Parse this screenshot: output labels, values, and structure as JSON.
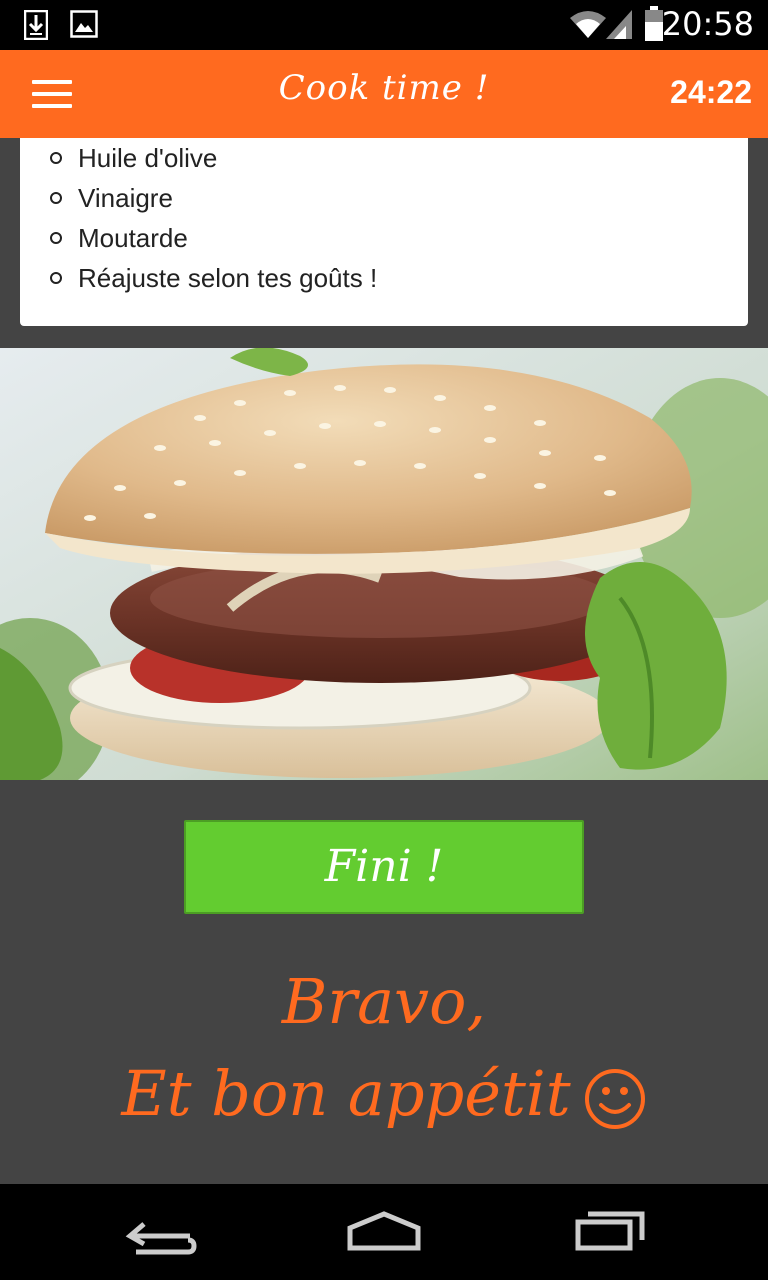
{
  "status_bar": {
    "time": "20:58",
    "icons": [
      "download-icon",
      "image-icon",
      "wifi-icon",
      "signal-icon",
      "battery-icon"
    ]
  },
  "app_bar": {
    "title": "Cook time !",
    "timer": "24:22",
    "menu_icon": "hamburger-menu-icon",
    "color": "#ff6a1f"
  },
  "ingredients": {
    "items": [
      "Huile d'olive",
      "Vinaigre",
      "Moutarde",
      "Réajuste selon tes goûts !"
    ]
  },
  "photo": {
    "subject": "burger-photo"
  },
  "finish_button": {
    "label": "Fini !",
    "color": "#63cc30"
  },
  "message": {
    "line1": "Bravo,",
    "line2": "Et bon appétit",
    "emoji_icon": "smiley-icon",
    "color": "#ff6a1f"
  },
  "nav_bar": {
    "icons": [
      "back-icon",
      "home-icon",
      "recent-apps-icon"
    ]
  }
}
